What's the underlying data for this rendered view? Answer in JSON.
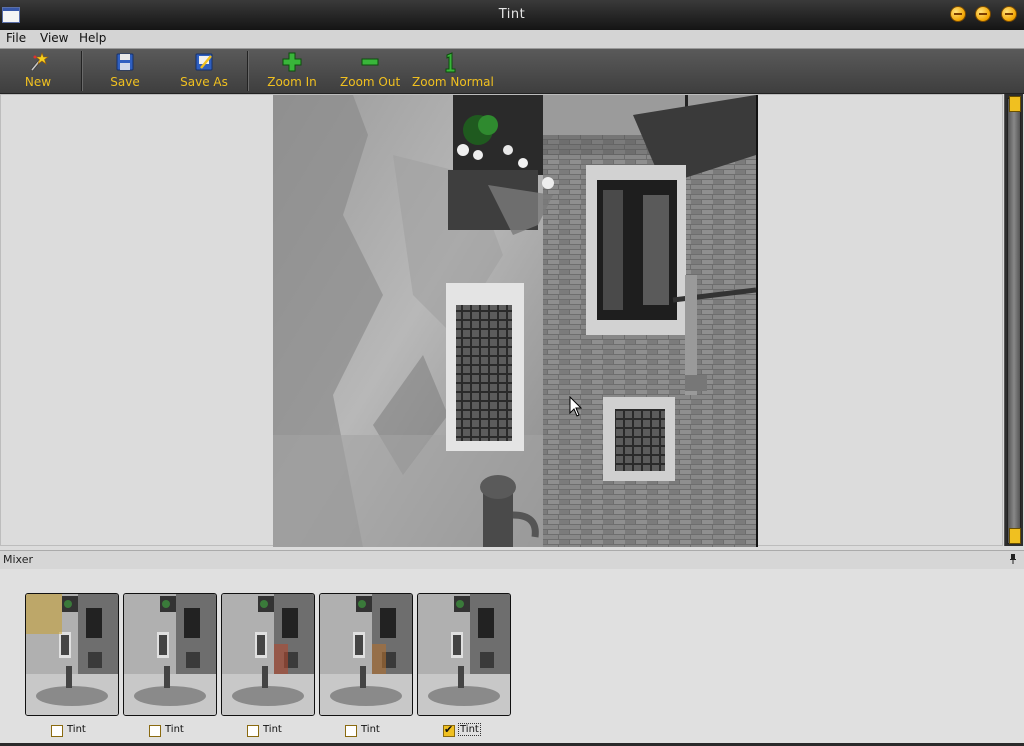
{
  "window": {
    "title": "Tint"
  },
  "menu": {
    "file": "File",
    "view": "View",
    "help": "Help"
  },
  "toolbar": {
    "new": "New",
    "save": "Save",
    "save_as": "Save As",
    "zoom_in": "Zoom In",
    "zoom_out": "Zoom Out",
    "zoom_normal": "Zoom Normal"
  },
  "mixer": {
    "title": "Mixer",
    "items": [
      {
        "label": "Tint",
        "checked": false,
        "accent": "#c8a030"
      },
      {
        "label": "Tint",
        "checked": false,
        "accent": "#5a6fa8"
      },
      {
        "label": "Tint",
        "checked": false,
        "accent": "#b04a30"
      },
      {
        "label": "Tint",
        "checked": false,
        "accent": "#b07030"
      },
      {
        "label": "Tint",
        "checked": true,
        "accent": "#4a8a3a"
      }
    ]
  },
  "colors": {
    "accent": "#f0c020",
    "toolbar_bg": "#4a4a4a"
  }
}
